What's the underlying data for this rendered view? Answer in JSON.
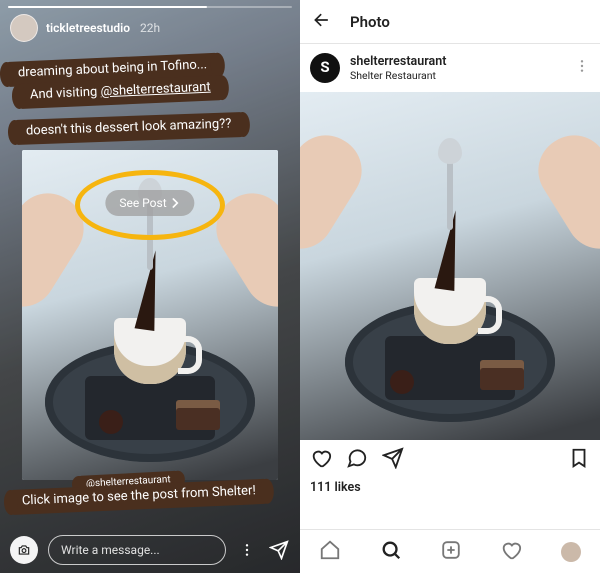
{
  "story": {
    "username": "tickletreestudio",
    "timestamp": "22h",
    "avatar": "avatar-tickletree",
    "lines": {
      "l1": "dreaming about being in Tofino...",
      "l2_pre": "And visiting ",
      "l2_mention": "@shelterrestaurant",
      "l3": "doesn't this dessert look amazing??",
      "l4": "@shelterrestaurant",
      "l5": "Click image to see the post from Shelter!"
    },
    "see_post_label": "See Post",
    "message_placeholder": "Write a message..."
  },
  "feed": {
    "header_title": "Photo",
    "post": {
      "avatar_letter": "S",
      "username": "shelterrestaurant",
      "location": "Shelter Restaurant",
      "likes_text": "111 likes"
    }
  },
  "colors": {
    "brush": "#4a2f1e",
    "highlight_ring": "#f6b50f"
  }
}
